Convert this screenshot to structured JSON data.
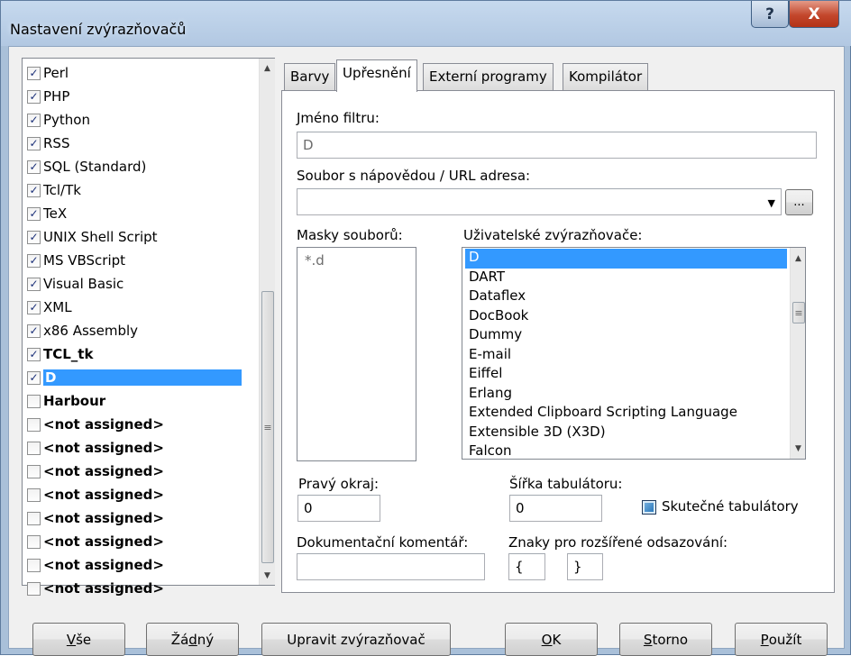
{
  "window": {
    "title": "Nastavení zvýrazňovačů",
    "help_glyph": "?",
    "close_glyph": "X"
  },
  "syntax_list": {
    "items": [
      {
        "label": "Perl",
        "checked": true,
        "bold": false,
        "selected": false
      },
      {
        "label": "PHP",
        "checked": true,
        "bold": false,
        "selected": false
      },
      {
        "label": "Python",
        "checked": true,
        "bold": false,
        "selected": false
      },
      {
        "label": "RSS",
        "checked": true,
        "bold": false,
        "selected": false
      },
      {
        "label": "SQL (Standard)",
        "checked": true,
        "bold": false,
        "selected": false
      },
      {
        "label": "Tcl/Tk",
        "checked": true,
        "bold": false,
        "selected": false
      },
      {
        "label": "TeX",
        "checked": true,
        "bold": false,
        "selected": false
      },
      {
        "label": "UNIX Shell Script",
        "checked": true,
        "bold": false,
        "selected": false
      },
      {
        "label": "MS VBScript",
        "checked": true,
        "bold": false,
        "selected": false
      },
      {
        "label": "Visual Basic",
        "checked": true,
        "bold": false,
        "selected": false
      },
      {
        "label": "XML",
        "checked": true,
        "bold": false,
        "selected": false
      },
      {
        "label": "x86 Assembly",
        "checked": true,
        "bold": false,
        "selected": false
      },
      {
        "label": "TCL_tk",
        "checked": true,
        "bold": true,
        "selected": false
      },
      {
        "label": "D",
        "checked": true,
        "bold": true,
        "selected": true
      },
      {
        "label": "Harbour",
        "checked": false,
        "bold": true,
        "selected": false
      },
      {
        "label": "<not assigned>",
        "checked": false,
        "bold": true,
        "selected": false
      },
      {
        "label": "<not assigned>",
        "checked": false,
        "bold": true,
        "selected": false
      },
      {
        "label": "<not assigned>",
        "checked": false,
        "bold": true,
        "selected": false
      },
      {
        "label": "<not assigned>",
        "checked": false,
        "bold": true,
        "selected": false
      },
      {
        "label": "<not assigned>",
        "checked": false,
        "bold": true,
        "selected": false
      },
      {
        "label": "<not assigned>",
        "checked": false,
        "bold": true,
        "selected": false
      },
      {
        "label": "<not assigned>",
        "checked": false,
        "bold": true,
        "selected": false
      },
      {
        "label": "<not assigned>",
        "checked": false,
        "bold": true,
        "selected": false
      }
    ]
  },
  "tabs": [
    {
      "label": "Barvy",
      "active": false
    },
    {
      "label": "Upřesnění",
      "active": true
    },
    {
      "label": "Externí programy",
      "active": false
    },
    {
      "label": "Kompilátor",
      "active": false
    }
  ],
  "advanced": {
    "filter_name_label": "Jméno filtru:",
    "filter_name_value": "D",
    "help_file_label": "Soubor s nápovědou / URL adresa:",
    "help_file_value": "",
    "browse_label": "...",
    "file_masks_label": "Masky souborů:",
    "file_masks_value": "*.d",
    "user_highlighters_label": "Uživatelské zvýrazňovače:",
    "user_highlighters": [
      "D",
      "DART",
      "Dataflex",
      "DocBook",
      "Dummy",
      "E-mail",
      "Eiffel",
      "Erlang",
      "Extended Clipboard Scripting Language",
      "Extensible 3D (X3D)",
      "Falcon"
    ],
    "selected_highlighter": "D",
    "right_margin_label": "Pravý okraj:",
    "right_margin_value": "0",
    "tab_width_label": "Šířka tabulátoru:",
    "tab_width_value": "0",
    "real_tabs_label": "Skutečné tabulátory",
    "doc_comment_label": "Dokumentační komentář:",
    "doc_comment_value": "",
    "indent_chars_label": "Znaky pro rozšířené odsazování:",
    "indent_open_value": "{",
    "indent_close_value": "}"
  },
  "buttons": {
    "all": {
      "underlined": "V",
      "rest": "še"
    },
    "none": {
      "pre": "Žá",
      "underlined": "d",
      "rest": "ný"
    },
    "edit_highlighter": "Upravit zvýrazňovač",
    "ok": {
      "underlined": "O",
      "rest": "K"
    },
    "cancel": {
      "underlined": "S",
      "rest": "torno"
    },
    "apply": {
      "underlined": "P",
      "rest": "oužít"
    }
  },
  "icons": {
    "check": "check-icon",
    "scroll_up": "chevron-up-icon",
    "scroll_down": "chevron-down-icon",
    "grip": "scroll-grip-icon"
  },
  "colors": {
    "selection": "#3399ff",
    "title_bar": "#b9cde4",
    "close_button": "#c3472c"
  }
}
